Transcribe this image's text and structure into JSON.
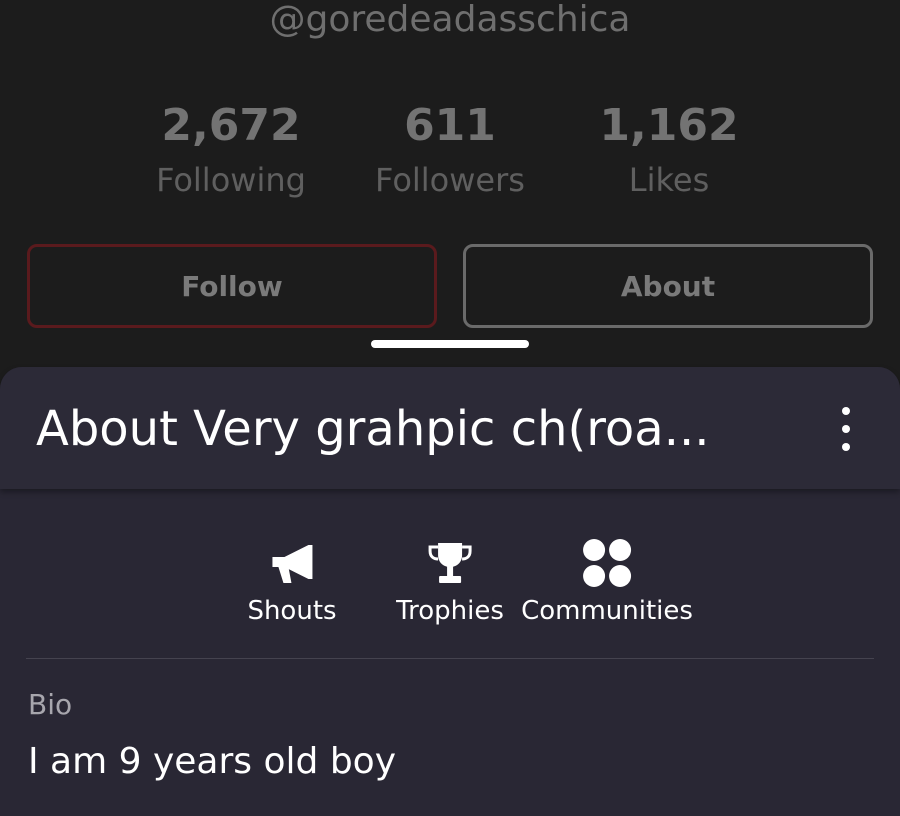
{
  "profile": {
    "handle": "@goredeadasschica"
  },
  "stats": [
    {
      "value": "2,672",
      "label": "Following"
    },
    {
      "value": "611",
      "label": "Followers"
    },
    {
      "value": "1,162",
      "label": "Likes"
    }
  ],
  "buttons": {
    "follow_label": "Follow",
    "about_label": "About"
  },
  "sheet": {
    "title": "About Very grahpic ch(roa...",
    "tabs": [
      {
        "label": "Shouts",
        "icon": "megaphone-icon"
      },
      {
        "label": "Trophies",
        "icon": "trophy-icon"
      },
      {
        "label": "Communities",
        "icon": "communities-icon"
      }
    ],
    "bio_label": "Bio",
    "bio_text": "I am 9 years old boy"
  },
  "colors": {
    "background": "#1c1c1c",
    "sheet": "#292734",
    "follow_border": "#5a1a1d",
    "muted_text": "#737373"
  }
}
